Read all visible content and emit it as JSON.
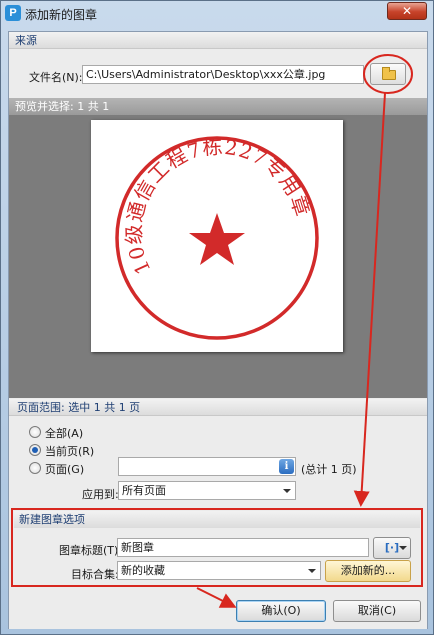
{
  "window": {
    "title": "添加新的图章",
    "app_icon_letter": "P",
    "close_glyph": "✕"
  },
  "source": {
    "section_label": "来源",
    "file_label": "文件名(N):",
    "file_value": "C:\\Users\\Administrator\\Desktop\\xxx公章.jpg"
  },
  "preview": {
    "header": "预览并选择: 1 共 1",
    "stamp_ring_text": "10级通信工程7栋227专用章"
  },
  "page_range": {
    "header": "页面范围: 选中 1 共 1 页",
    "options": [
      {
        "label": "全部(A)",
        "selected": false
      },
      {
        "label": "当前页(R)",
        "selected": true
      },
      {
        "label": "页面(G)",
        "selected": false
      }
    ],
    "pages_value": "",
    "info_glyph": "i",
    "total_text": "(总计 1 页)",
    "apply_label": "应用到:",
    "apply_value": "所有页面"
  },
  "new_stamp": {
    "section_label": "新建图章选项",
    "title_label": "图章标题(T):",
    "title_value": "新图章",
    "collection_label": "目标合集:",
    "collection_value": "新的收藏",
    "add_new_label": "添加新的...",
    "field_menu_glyph": "[·]"
  },
  "buttons": {
    "ok": "确认(O)",
    "cancel": "取消(C)"
  },
  "colors": {
    "annotation_red": "#d8271f",
    "stamp_red": "#d22a2a"
  }
}
